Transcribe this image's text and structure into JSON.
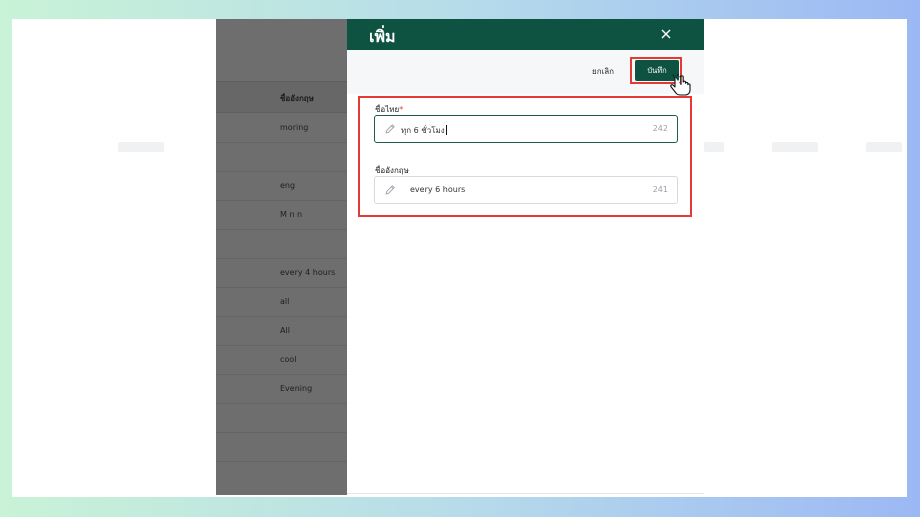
{
  "list": {
    "header": "ชื่ออังกฤษ",
    "rows": [
      "moring",
      "",
      "eng",
      "M n n",
      "",
      "every 4 hours",
      "all",
      "All",
      "cool",
      "Evening",
      "",
      ""
    ]
  },
  "drawer": {
    "title": "เพิ่ม",
    "close_icon": "close-icon",
    "cancel_label": "ยกเลิก",
    "save_label": "บันทึก",
    "fields": [
      {
        "label": "ชื่อไทย",
        "required": "*",
        "value": "ทุก 6 ชั่วโมง",
        "counter": "242",
        "state": "focused"
      },
      {
        "label": "ชื่ออังกฤษ",
        "required": "",
        "value": "every 6 hours",
        "counter": "241",
        "state": "idle"
      }
    ]
  },
  "colors": {
    "brand": "#0e5241",
    "highlight": "#e53935",
    "overlay": "#6e6e6e"
  }
}
